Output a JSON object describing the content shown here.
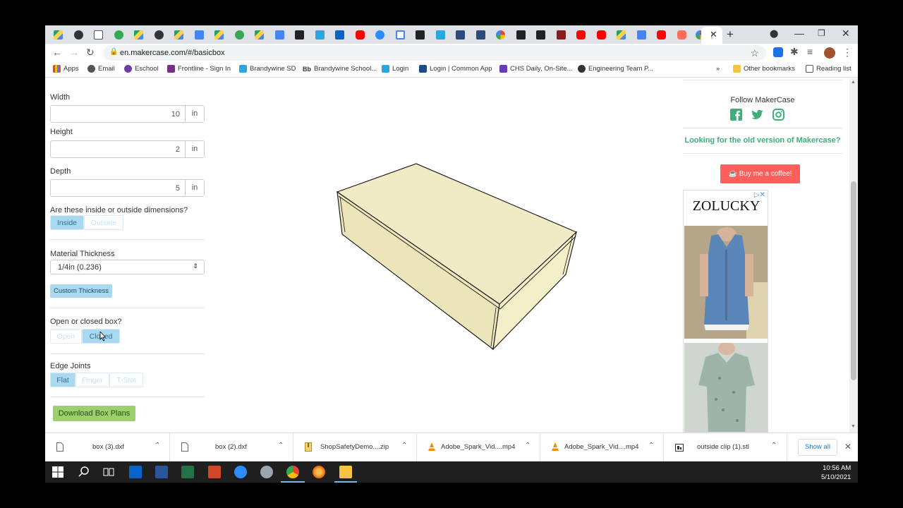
{
  "browser": {
    "url": "en.makercase.com/#/basicbox",
    "bookmarks": [
      "Apps",
      "Email",
      "Eschool",
      "Frontline - Sign In",
      "Brandywine SD",
      "Brandywine School...",
      "Login",
      "Login | Common App",
      "CHS Daily, On-Site...",
      "Engineering Team P..."
    ],
    "bookmarks_overflow": "»",
    "other_bookmarks": "Other bookmarks",
    "reading_list": "Reading list"
  },
  "form": {
    "width": {
      "label": "Width",
      "value": "10",
      "unit": "in"
    },
    "height": {
      "label": "Height",
      "value": "2",
      "unit": "in"
    },
    "depth": {
      "label": "Depth",
      "value": "5",
      "unit": "in"
    },
    "dimensions": {
      "question": "Are these inside or outside dimensions?",
      "options": [
        "Inside",
        "Outside"
      ],
      "selected": "Inside"
    },
    "material": {
      "label": "Material Thickness",
      "value": "1/4in (0.236)",
      "custom_button": "Custom Thickness"
    },
    "open_closed": {
      "question": "Open or closed box?",
      "options": [
        "Open",
        "Closed"
      ],
      "selected": "Closed"
    },
    "edge_joints": {
      "label": "Edge Joints",
      "options": [
        "Flat",
        "Finger",
        "T-Slot"
      ],
      "selected": "Flat"
    },
    "download_button": "Download Box Plans"
  },
  "sidebar": {
    "follow_label": "Follow MakerCase",
    "old_version_link": "Looking for the old version of Makercase?",
    "coffee_button": "Buy me a coffee!",
    "ad_brand": "ZOLUCKY"
  },
  "downloads": [
    {
      "name": "box (3).dxf"
    },
    {
      "name": "box (2).dxf"
    },
    {
      "name": "ShopSafetyDemo....zip"
    },
    {
      "name": "Adobe_Spark_Vid....mp4"
    },
    {
      "name": "Adobe_Spark_Vid....mp4"
    },
    {
      "name": "outside clip (1).stl"
    }
  ],
  "show_all": "Show all",
  "taskbar": {
    "time": "10:56 AM",
    "date": "5/10/2021"
  },
  "colors": {
    "box_fill": "#f1ebc5",
    "accent_green": "#3fae78",
    "segment_on": "#a9d8f1",
    "download_green": "#9ccf6e",
    "coffee_red": "#ff5e5b"
  }
}
